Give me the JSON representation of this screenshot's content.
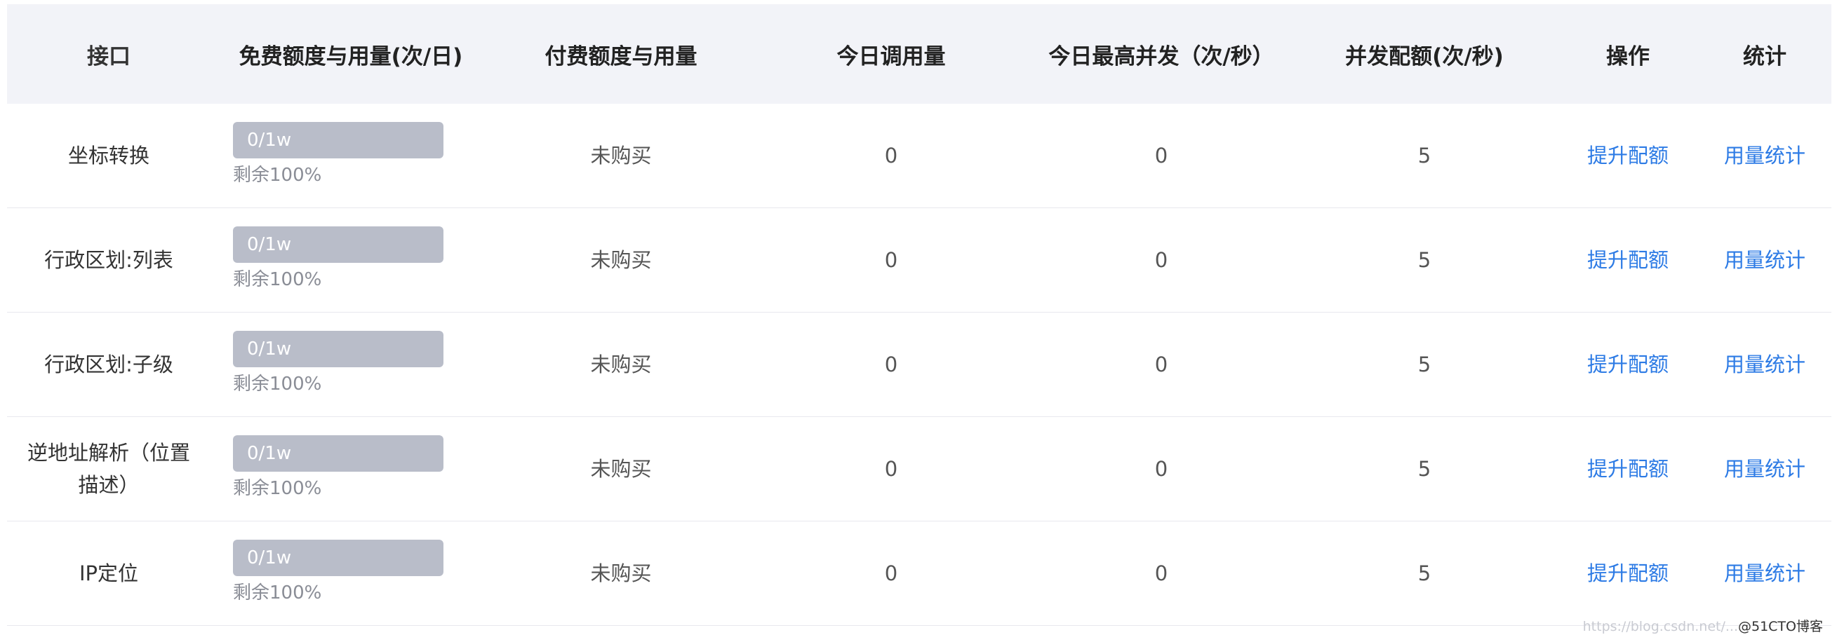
{
  "headers": {
    "api": "接口",
    "free": "免费额度与用量(次/日)",
    "paid": "付费额度与用量",
    "today": "今日调用量",
    "peak": "今日最高并发（次/秒）",
    "quota": "并发配额(次/秒)",
    "op": "操作",
    "stat": "统计"
  },
  "rows": [
    {
      "name": "坐标转换",
      "free_usage": "0/1w",
      "used_fraction": 0,
      "remaining": "剩余100%",
      "paid": "未购买",
      "today": "0",
      "peak": "0",
      "quota": "5",
      "op": "提升配额",
      "stat": "用量统计"
    },
    {
      "name": "行政区划:列表",
      "free_usage": "0/1w",
      "used_fraction": 0,
      "remaining": "剩余100%",
      "paid": "未购买",
      "today": "0",
      "peak": "0",
      "quota": "5",
      "op": "提升配额",
      "stat": "用量统计"
    },
    {
      "name": "行政区划:子级",
      "free_usage": "0/1w",
      "used_fraction": 0,
      "remaining": "剩余100%",
      "paid": "未购买",
      "today": "0",
      "peak": "0",
      "quota": "5",
      "op": "提升配额",
      "stat": "用量统计"
    },
    {
      "name": "逆地址解析（位置描述）",
      "free_usage": "0/1w",
      "used_fraction": 0,
      "remaining": "剩余100%",
      "paid": "未购买",
      "today": "0",
      "peak": "0",
      "quota": "5",
      "op": "提升配额",
      "stat": "用量统计"
    },
    {
      "name": "IP定位",
      "free_usage": "0/1w",
      "used_fraction": 0,
      "remaining": "剩余100%",
      "paid": "未购买",
      "today": "0",
      "peak": "0",
      "quota": "5",
      "op": "提升配额",
      "stat": "用量统计"
    }
  ],
  "colors": {
    "link": "#2d7be5",
    "header_bg": "#f2f3f8",
    "bar_fill": "#b9bdc9"
  },
  "watermark": {
    "url": "https://blog.csdn.net/...",
    "tag": "@51CTO博客"
  }
}
